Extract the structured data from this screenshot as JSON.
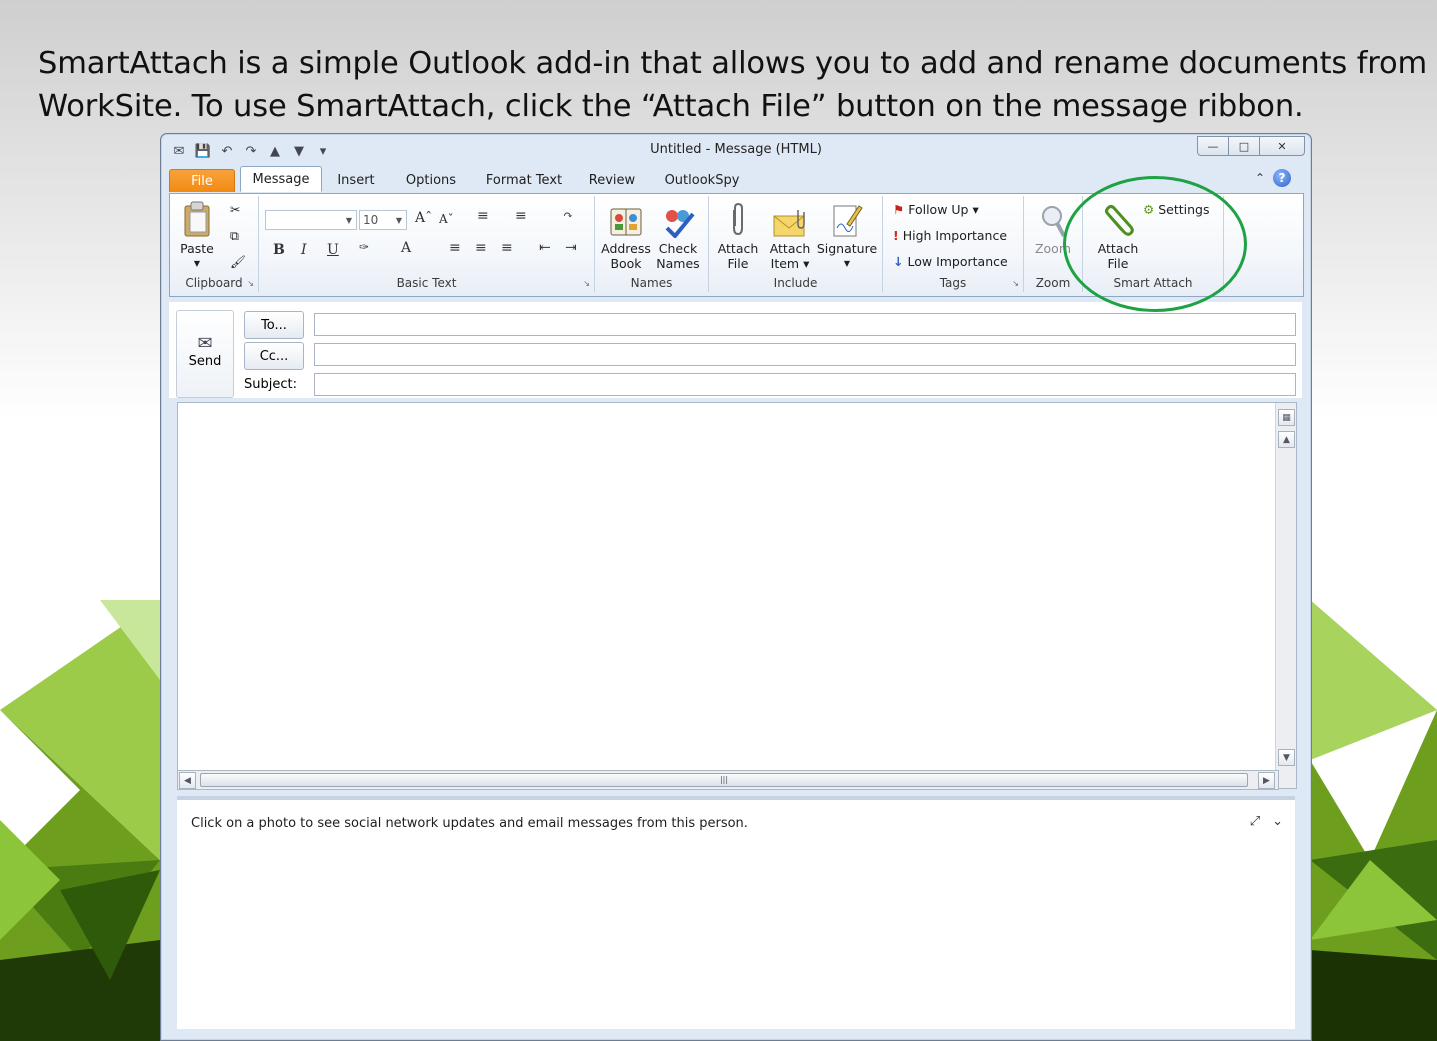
{
  "caption": {
    "line1": "SmartAttach is a simple Outlook add-in that allows you to add and rename documents from",
    "line2": "WorkSite. To use SmartAttach, click the “Attach File” button on the message ribbon."
  },
  "window": {
    "title": "Untitled  -  Message (HTML)",
    "controls": {
      "minimize": "—",
      "restore": "□",
      "close": "✕"
    }
  },
  "tabs": [
    {
      "label": "File"
    },
    {
      "label": "Message"
    },
    {
      "label": "Insert"
    },
    {
      "label": "Options"
    },
    {
      "label": "Format Text"
    },
    {
      "label": "Review"
    },
    {
      "label": "OutlookSpy"
    }
  ],
  "help": {
    "label": "?"
  },
  "ribbon": {
    "clipboard": {
      "paste": "Paste",
      "label": "Clipboard"
    },
    "basic_text": {
      "font_size": "10",
      "bold": "B",
      "italic": "I",
      "underline": "U",
      "label": "Basic Text"
    },
    "names": {
      "address_book_1": "Address",
      "address_book_2": "Book",
      "check_names_1": "Check",
      "check_names_2": "Names",
      "label": "Names"
    },
    "include": {
      "attach_file_1": "Attach",
      "attach_file_2": "File",
      "attach_item_1": "Attach",
      "attach_item_2": "Item ▾",
      "signature": "Signature",
      "label": "Include"
    },
    "tags": {
      "follow_up": "Follow Up ▾",
      "high_importance": "High Importance",
      "low_importance": "Low Importance",
      "label": "Tags"
    },
    "zoom": {
      "zoom": "Zoom",
      "label": "Zoom"
    },
    "smart_attach": {
      "attach_file_1": "Attach",
      "attach_file_2": "File",
      "settings": "Settings",
      "label": "Smart Attach"
    }
  },
  "compose": {
    "send": "Send",
    "to": "To...",
    "cc": "Cc...",
    "subject": "Subject:"
  },
  "people_pane": {
    "text": "Click on a photo to see social network updates and email messages from this person."
  },
  "colors": {
    "highlight_circle": "#1ea243",
    "file_tab": "#f28a12"
  }
}
